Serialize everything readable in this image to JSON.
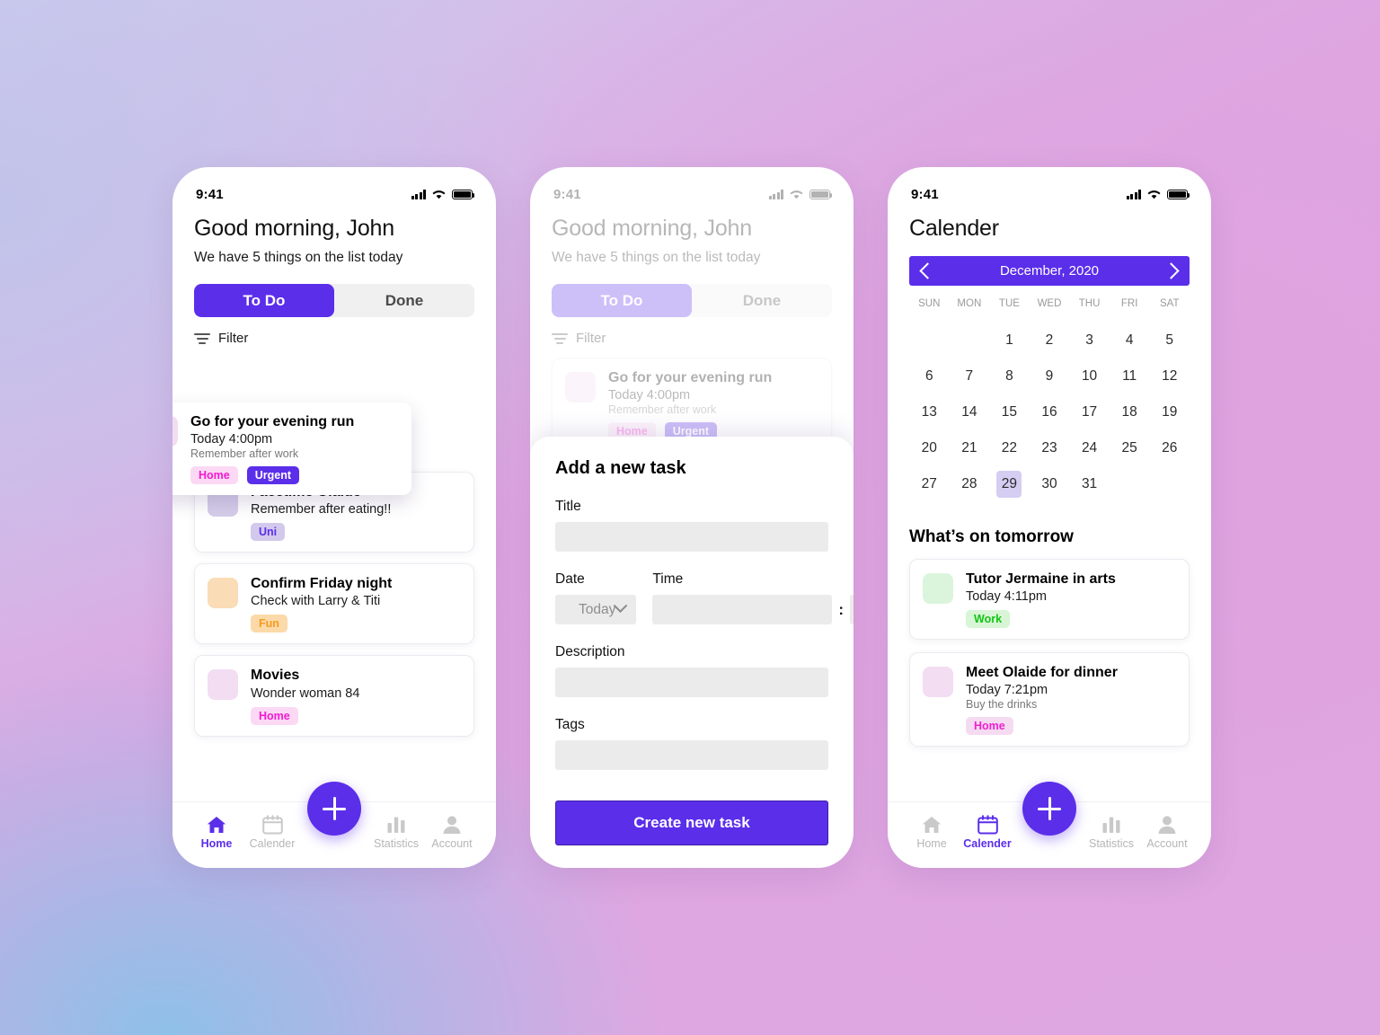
{
  "background": {
    "accent": "#5b2eea"
  },
  "status_bar": {
    "time": "9:41",
    "signal_icon": "cellular-bars-icon",
    "wifi_icon": "wifi-icon",
    "battery_icon": "battery-icon"
  },
  "bottom_nav": {
    "add_button_label": "+",
    "items": [
      {
        "label": "Home",
        "icon": "home-icon"
      },
      {
        "label": "Calender",
        "icon": "calendar-icon"
      },
      {
        "label": "Statistics",
        "icon": "bar-chart-icon"
      },
      {
        "label": "Account",
        "icon": "person-icon"
      }
    ]
  },
  "phone1": {
    "greeting": "Good morning, John",
    "subgreeting": "We have 5 things on the list today",
    "tabs": [
      {
        "label": "To Do",
        "active": true
      },
      {
        "label": "Done",
        "active": false
      }
    ],
    "filter": {
      "label": "Filter",
      "icon": "filter-icon"
    },
    "floating_task": {
      "title": "Go for your evening run",
      "time": "Today 4:00pm",
      "note": "Remember after work",
      "swatch": "#f3ddf3",
      "tags": [
        {
          "label": "Home",
          "bg": "#fbd9f4",
          "fg": "#f41ad1"
        },
        {
          "label": "Urgent",
          "bg": "#5b2eea",
          "fg": "#ffffff"
        }
      ]
    },
    "tasks": [
      {
        "title": "Facetime Olaide",
        "time": "Remember after eating!!",
        "note": "",
        "swatch": "#d6cdea",
        "tags": [
          {
            "label": "Uni",
            "bg": "#d3c9ec",
            "fg": "#5b2eea"
          }
        ]
      },
      {
        "title": "Confirm Friday night",
        "time": "Check with Larry & Titi",
        "note": "",
        "swatch": "#fadcb6",
        "tags": [
          {
            "label": "Fun",
            "bg": "#fbd9a8",
            "fg": "#f59b21"
          }
        ]
      },
      {
        "title": "Movies",
        "time": "Wonder woman 84",
        "note": "",
        "swatch": "#f3ddf3",
        "tags": [
          {
            "label": "Home",
            "bg": "#fbd9f4",
            "fg": "#f41ad1"
          }
        ]
      }
    ],
    "active_nav": "Home"
  },
  "phone2": {
    "greeting": "Good morning, John",
    "subgreeting": "We have 5 things on the list today",
    "tabs": [
      {
        "label": "To Do",
        "active": true
      },
      {
        "label": "Done",
        "active": false
      }
    ],
    "filter": {
      "label": "Filter"
    },
    "background_task": {
      "title": "Go for your evening run",
      "time": "Today 4:00pm",
      "note": "Remember after work",
      "swatch": "#f3ddf3",
      "tags": [
        {
          "label": "Home",
          "bg": "#fbd9f4",
          "fg": "#f41ad1"
        },
        {
          "label": "Urgent",
          "bg": "#5b2eea",
          "fg": "#ffffff"
        }
      ]
    },
    "sheet": {
      "title": "Add a new task",
      "title_label": "Title",
      "title_value": "",
      "title_placeholder": "",
      "date_label": "Date",
      "date_value": "Today",
      "time_label": "Time",
      "time_hour": "",
      "time_minute": "",
      "time_separator": ":",
      "description_label": "Description",
      "description_value": "",
      "tags_label": "Tags",
      "tags_value": "",
      "submit_label": "Create new task"
    }
  },
  "phone3": {
    "title": "Calender",
    "calendar": {
      "month": "December, 2020",
      "prev_icon": "chevron-left-icon",
      "next_icon": "chevron-right-icon",
      "weekdays": [
        "SUN",
        "MON",
        "TUE",
        "WED",
        "THU",
        "FRI",
        "SAT"
      ],
      "leading_blanks": 2,
      "days": [
        1,
        2,
        3,
        4,
        5,
        6,
        7,
        8,
        9,
        10,
        11,
        12,
        13,
        14,
        15,
        16,
        17,
        18,
        19,
        20,
        21,
        22,
        23,
        24,
        25,
        26,
        27,
        28,
        29,
        30,
        31
      ],
      "selected_day": 29
    },
    "section_title": "What’s on tomorrow",
    "events": [
      {
        "title": "Tutor Jermaine in arts",
        "time": "Today 4:11pm",
        "note": "",
        "swatch": "#dbf5dc",
        "tags": [
          {
            "label": "Work",
            "bg": "#d8f5d6",
            "fg": "#13c413"
          }
        ]
      },
      {
        "title": "Meet Olaide for dinner",
        "time": "Today 7:21pm",
        "note": "Buy the drinks",
        "swatch": "#f3ddf3",
        "tags": [
          {
            "label": "Home",
            "bg": "#f5dbf2",
            "fg": "#ef1fd0"
          }
        ]
      }
    ],
    "active_nav": "Calender"
  }
}
